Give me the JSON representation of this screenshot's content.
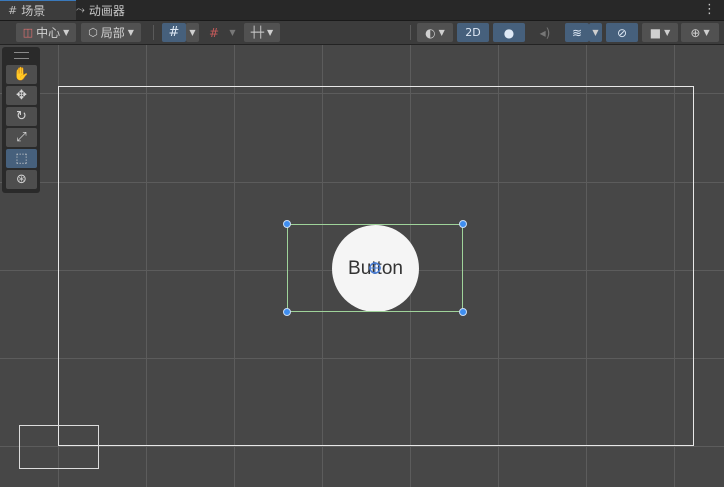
{
  "tabs": [
    {
      "label": "场景",
      "icon": "hash-grid-icon",
      "active": true
    },
    {
      "label": "动画器",
      "icon": "fork-icon",
      "active": false
    }
  ],
  "toolbar": {
    "pivot_label": "中心",
    "space_label": "局部",
    "mode_2d_label": "2D"
  },
  "scene": {
    "button_text": "Button",
    "accent_selection": "#9fd39a",
    "handle_color": "#3f8ef0"
  },
  "tools": [
    "view-hand-icon",
    "move-icon",
    "rotate-icon",
    "scale-icon",
    "rect-transform-icon",
    "transform-all-icon"
  ]
}
